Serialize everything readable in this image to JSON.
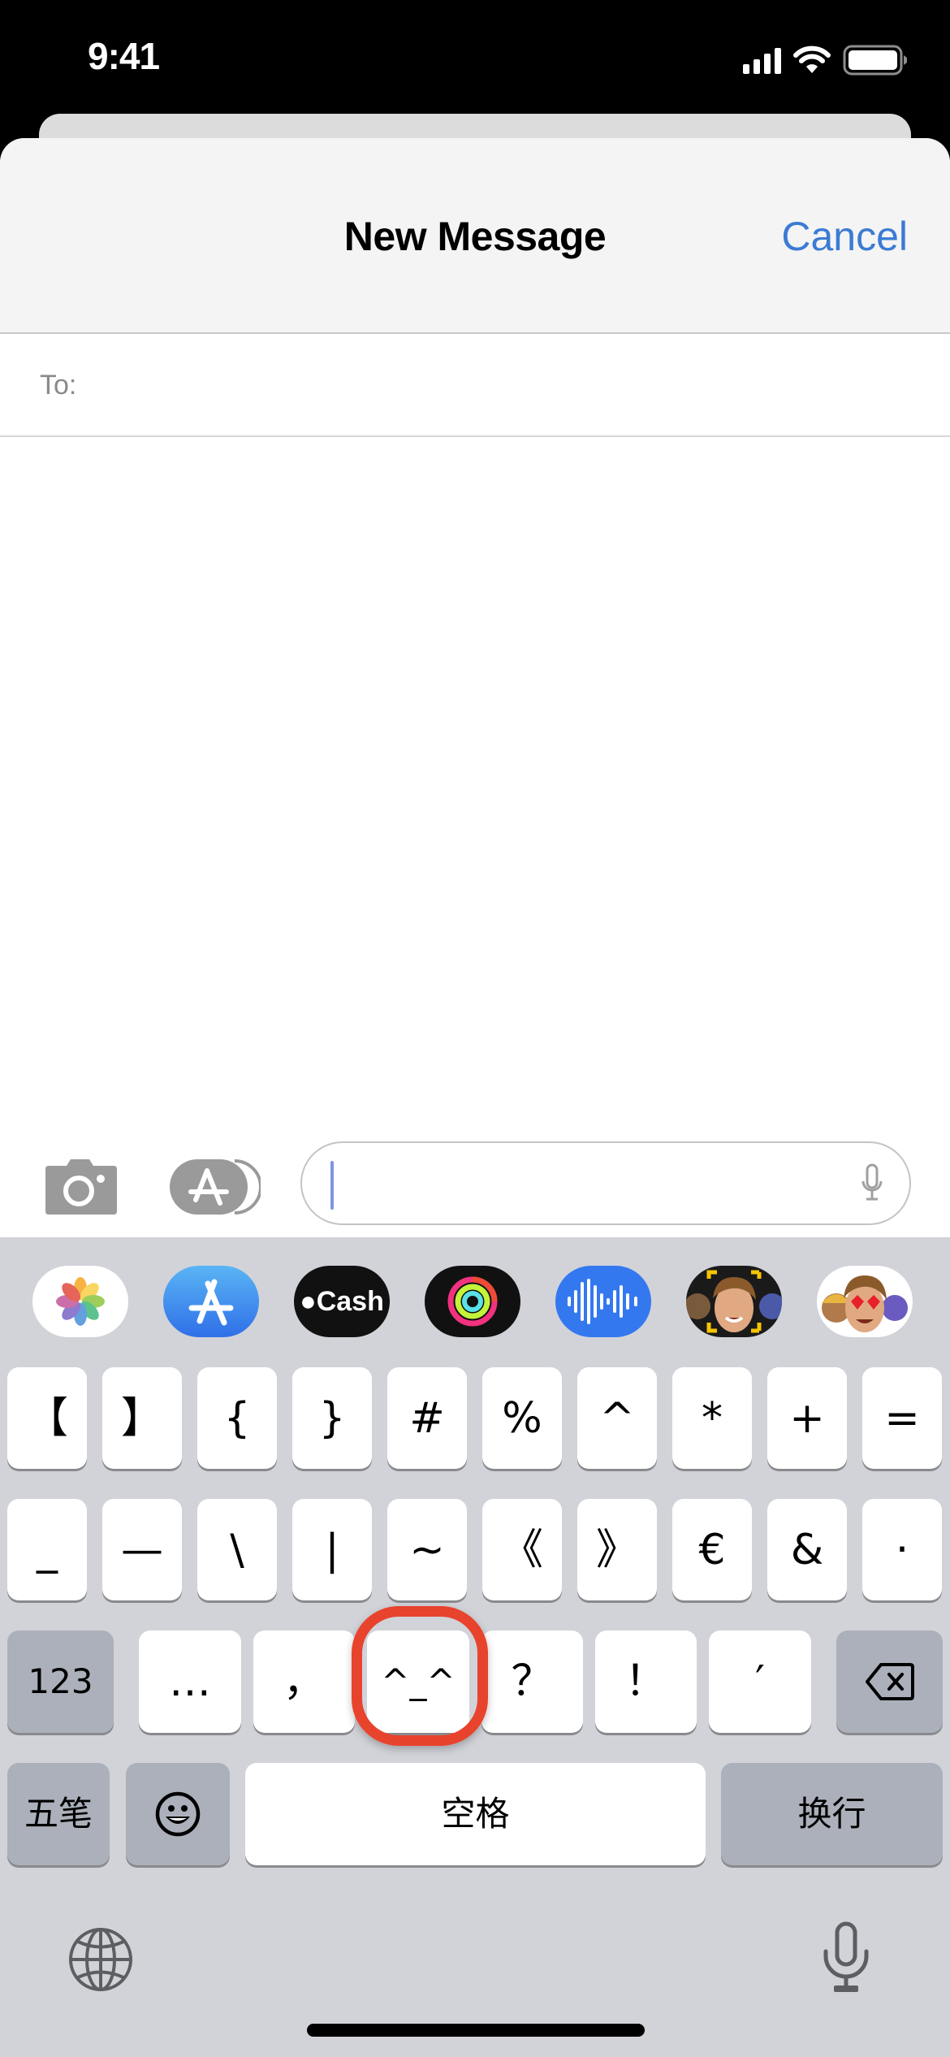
{
  "status_bar": {
    "time": "9:41",
    "icons": [
      "cellular-signal-icon",
      "wifi-icon",
      "battery-icon"
    ]
  },
  "nav": {
    "title": "New Message",
    "cancel_label": "Cancel",
    "accent_color": "#3b7bd4"
  },
  "to_field": {
    "label": "To:",
    "value": ""
  },
  "compose": {
    "camera_icon": "camera-icon",
    "apps_icon": "app-store-icon",
    "message_value": "",
    "mic_icon": "microphone-icon"
  },
  "app_strip": [
    {
      "name": "Photos",
      "icon": "photos-icon"
    },
    {
      "name": "App Store",
      "icon": "app-store-icon"
    },
    {
      "name": "Cash",
      "label": "Cash",
      "icon": "apple-cash-icon"
    },
    {
      "name": "Activity",
      "icon": "activity-rings-icon"
    },
    {
      "name": "Voice Memo",
      "icon": "audio-waveform-icon"
    },
    {
      "name": "Memoji Camera",
      "icon": "memoji-camera-icon"
    },
    {
      "name": "Memoji Stickers",
      "icon": "memoji-stickers-icon"
    }
  ],
  "keyboard": {
    "row1": [
      "【",
      "】",
      "{",
      "}",
      "#",
      "%",
      "^",
      "*",
      "+",
      "="
    ],
    "row2": [
      "_",
      "—",
      "\\",
      "|",
      "~",
      "《",
      "》",
      "€",
      "&",
      "·"
    ],
    "row3": {
      "mode_key": "123",
      "keys": [
        "…",
        "，",
        "^_^",
        "？",
        "！",
        "′"
      ],
      "delete_icon": "backspace-icon"
    },
    "row4": {
      "input_method": "五笔",
      "emoji_icon": "emoji-icon",
      "space": "空格",
      "return": "换行"
    },
    "globe_icon": "globe-icon",
    "dictation_icon": "microphone-icon",
    "highlighted_key": "^_^",
    "highlight_color": "#e8432d"
  }
}
